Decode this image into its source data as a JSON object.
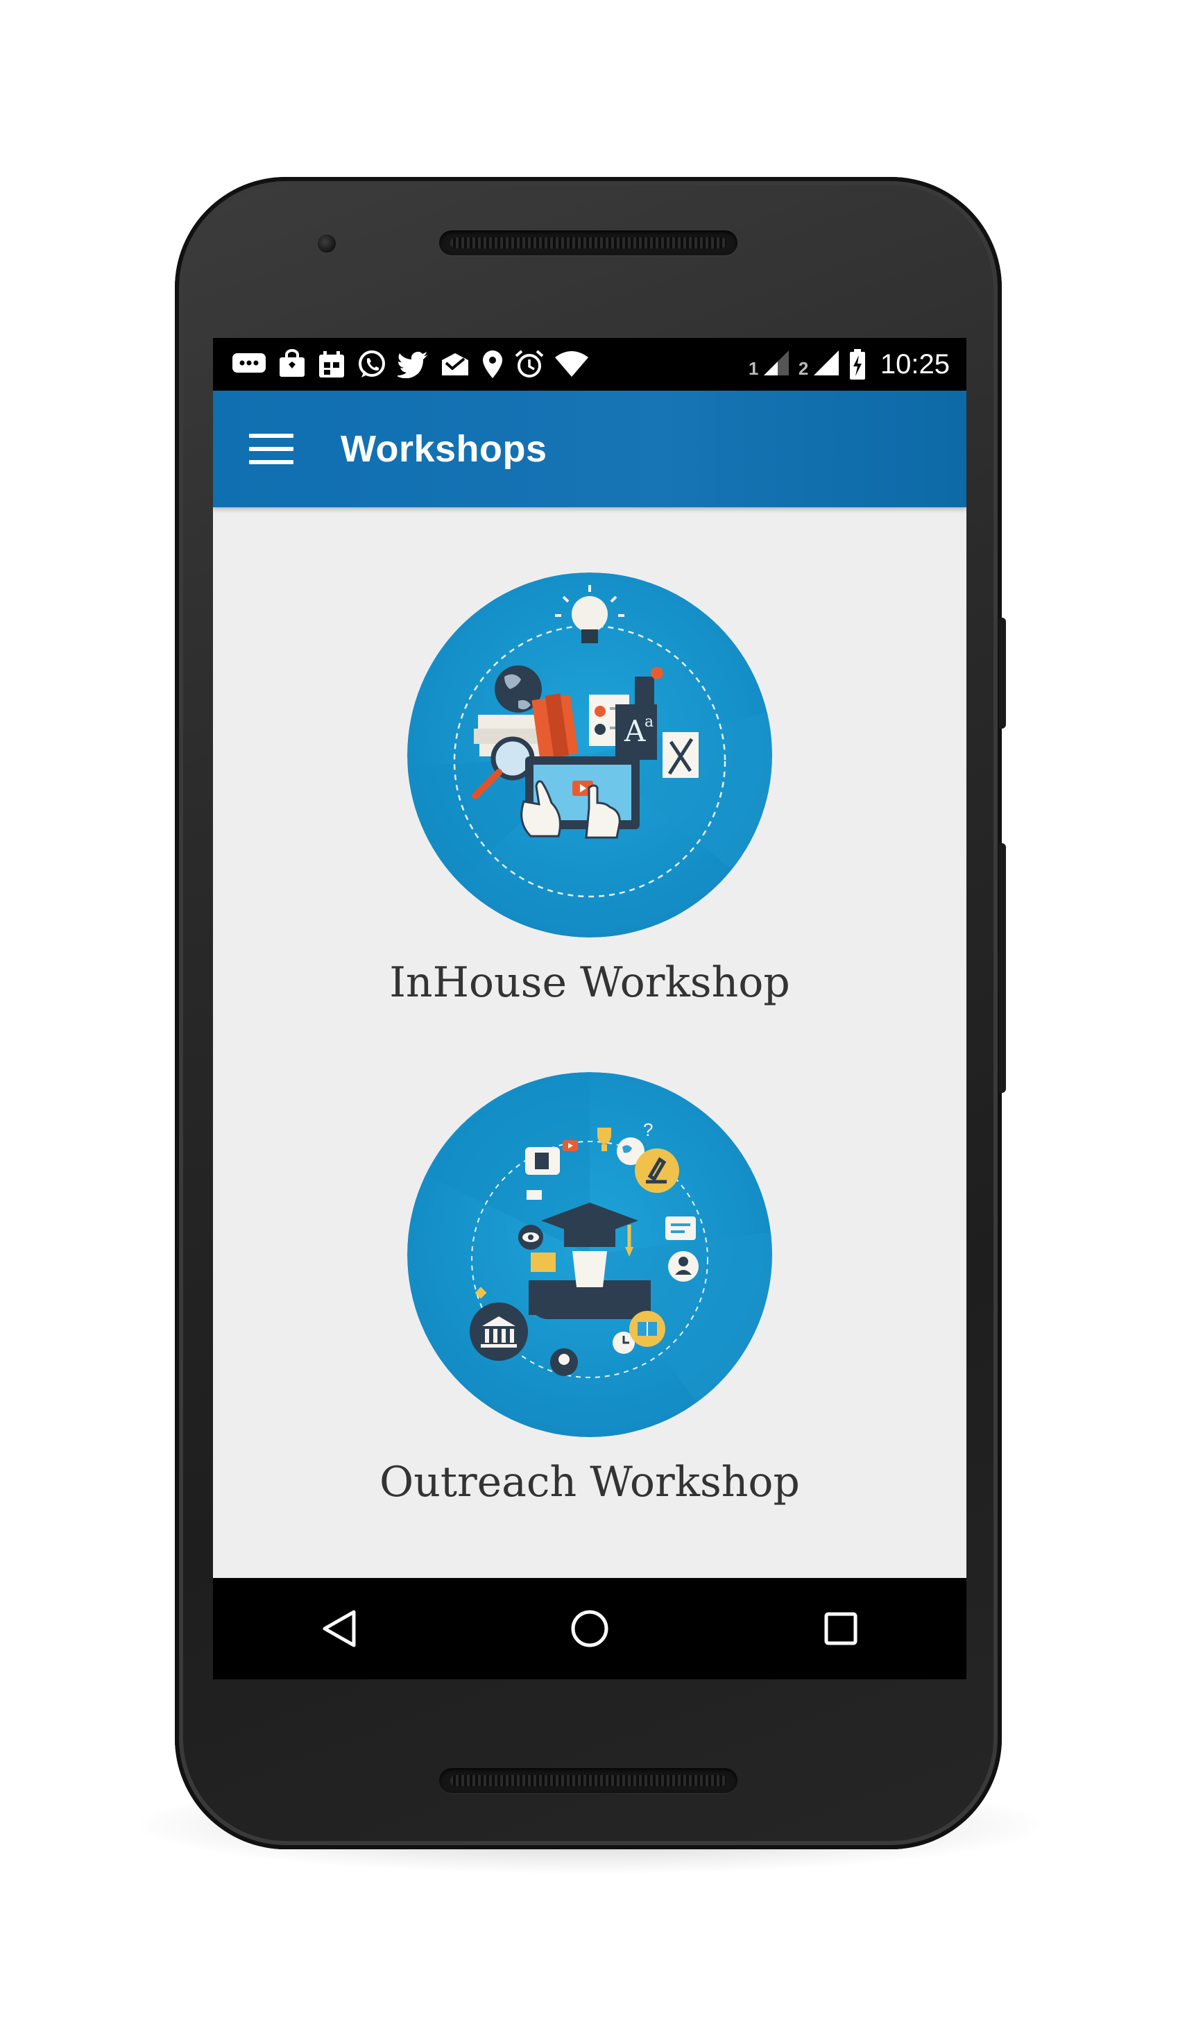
{
  "status_bar": {
    "time": "10:25",
    "sim1_label": "1",
    "sim2_label": "2",
    "icons": [
      "chat-icon",
      "shopping-bag-icon",
      "calendar-icon",
      "whatsapp-icon",
      "twitter-icon",
      "mail-check-icon",
      "location-icon",
      "alarm-icon",
      "wifi-icon",
      "signal-icon",
      "signal-icon",
      "battery-charging-icon"
    ]
  },
  "app_bar": {
    "title": "Workshops",
    "menu_icon": "hamburger-menu-icon"
  },
  "workshops": [
    {
      "label": "InHouse Workshop",
      "icon": "inhouse-workshop-illustration"
    },
    {
      "label": "Outreach Workshop",
      "icon": "outreach-workshop-illustration"
    }
  ],
  "nav_bar": {
    "buttons": [
      "back-icon",
      "home-icon",
      "recents-icon"
    ]
  },
  "colors": {
    "app_bar": "#1774b5",
    "screen_bg": "#eeeeee",
    "circle_blue": "#1597cf",
    "text": "#333333"
  }
}
